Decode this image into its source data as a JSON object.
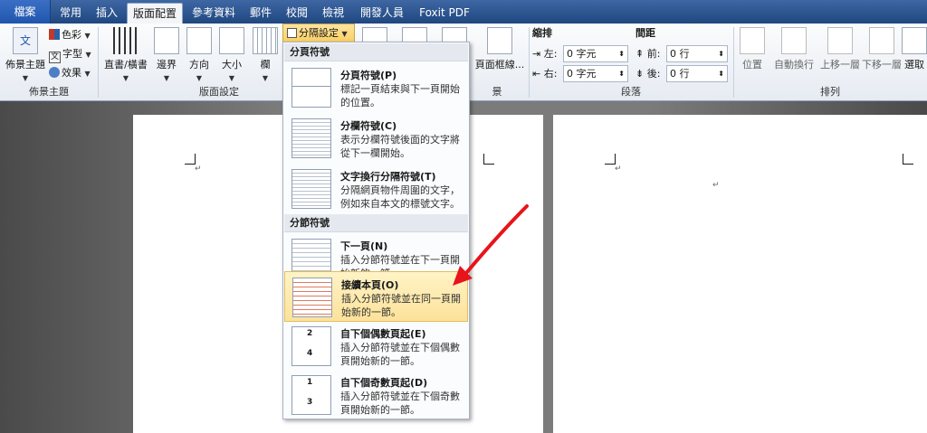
{
  "tabs": [
    {
      "label": "檔案"
    },
    {
      "label": "常用"
    },
    {
      "label": "插入"
    },
    {
      "label": "版面配置"
    },
    {
      "label": "參考資料"
    },
    {
      "label": "郵件"
    },
    {
      "label": "校閱"
    },
    {
      "label": "檢視"
    },
    {
      "label": "開發人員"
    },
    {
      "label": "Foxit PDF"
    }
  ],
  "ribbon": {
    "theme_group": {
      "label": "佈景主題",
      "theme_btn": "佈景主題",
      "colors": "色彩",
      "fonts": "字型",
      "effects": "效果"
    },
    "page_setup_group": {
      "label": "版面設定",
      "orientation_text": "直書/橫書",
      "margins": "邊界",
      "direction": "方向",
      "size": "大小",
      "columns": "欄",
      "breaks": "分隔設定"
    },
    "page_bg_group": {
      "label": "景",
      "page_borders": "頁面框線..."
    },
    "paragraph_group": {
      "label": "段落",
      "indent": "縮排",
      "spacing": "間距",
      "left_label": "左:",
      "right_label": "右:",
      "before_label": "前:",
      "after_label": "後:",
      "left_value": "0 字元",
      "right_value": "0 字元",
      "before_value": "0 行",
      "after_value": "0 行"
    },
    "arrange_group": {
      "label": "排列",
      "position": "位置",
      "wrap": "自動換行",
      "bring_forward": "上移一層",
      "send_backward": "下移一層",
      "selection": "選取"
    }
  },
  "menu": {
    "section1": "分頁符號",
    "section2": "分節符號",
    "items": [
      {
        "title": "分頁符號(P)",
        "desc": "標記一頁結束與下一頁開始的位置。"
      },
      {
        "title": "分欄符號(C)",
        "desc": "表示分欄符號後面的文字將從下一欄開始。"
      },
      {
        "title": "文字換行分隔符號(T)",
        "desc": "分隔網頁物件周圍的文字，例如來自本文的標號文字。"
      },
      {
        "title": "下一頁(N)",
        "desc": "插入分節符號並在下一頁開始新的一節。"
      },
      {
        "title": "接續本頁(O)",
        "desc": "插入分節符號並在同一頁開始新的一節。"
      },
      {
        "title": "自下個偶數頁起(E)",
        "desc": "插入分節符號並在下個偶數頁開始新的一節。"
      },
      {
        "title": "自下個奇數頁起(D)",
        "desc": "插入分節符號並在下個奇數頁開始新的一節。"
      }
    ],
    "thumb_labels": {
      "even_top": "2",
      "even_bottom": "4",
      "odd_top": "1",
      "odd_bottom": "3"
    }
  },
  "document": {
    "para_mark": "↵"
  },
  "colors": {
    "highlight": "#fde49f",
    "arrow": "#e8141b",
    "tab_bg": "#2a4f86"
  }
}
